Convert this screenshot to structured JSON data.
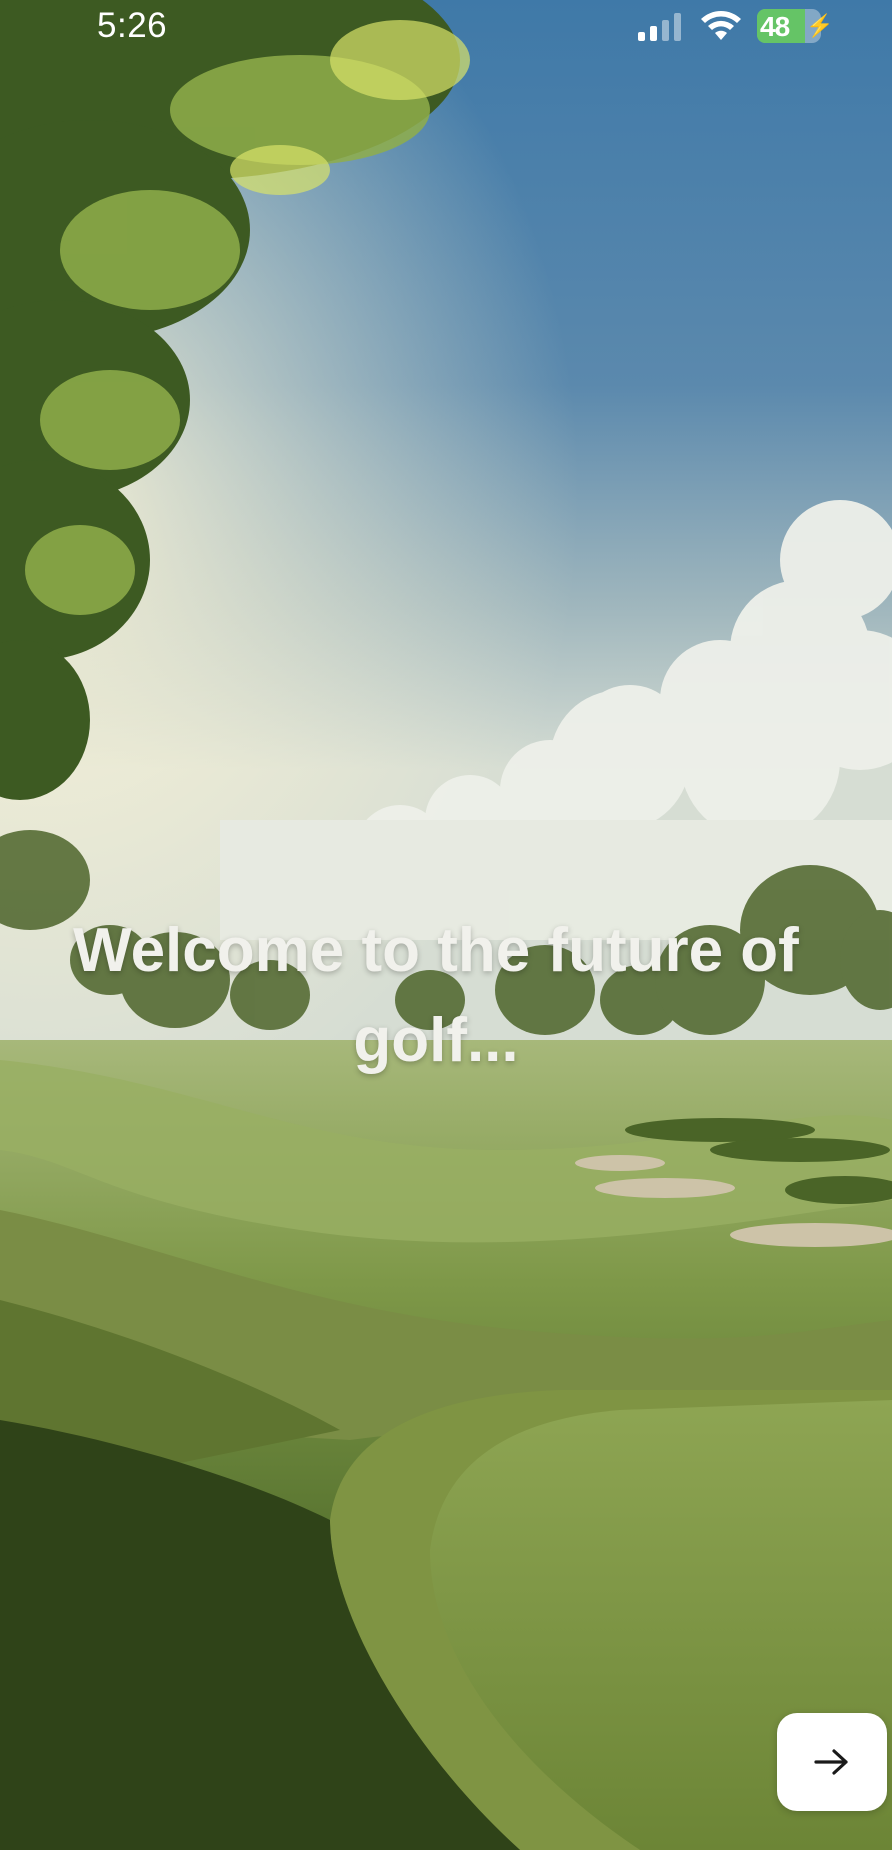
{
  "status_bar": {
    "time": "5:26",
    "battery_level": "48",
    "icons": [
      "cellular-signal-icon",
      "wifi-icon",
      "battery-charging-icon"
    ]
  },
  "hero": {
    "welcome_text": "Welcome to the future of golf..."
  },
  "next_button": {
    "icon": "arrow-right-icon"
  },
  "colors": {
    "sky": "#4f7fa6",
    "grass": "#6f8f3a",
    "battery": "#65c466",
    "button": "#ffffff",
    "text": "#f1f1ec"
  }
}
